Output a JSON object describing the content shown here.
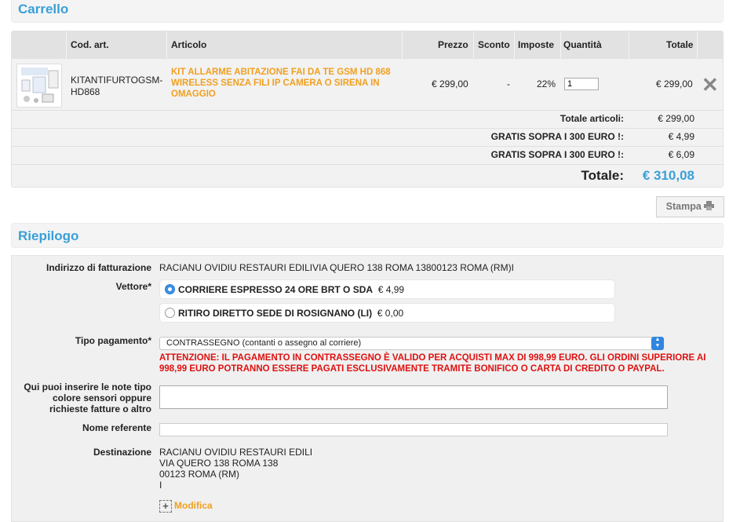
{
  "cart": {
    "title": "Carrello",
    "headers": [
      "Cod. art.",
      "Articolo",
      "Prezzo",
      "Sconto",
      "Imposte",
      "Quantità",
      "Totale"
    ],
    "item": {
      "code": "KITANTIFURTOGSM-HD868",
      "name": "KIT ALLARME ABITAZIONE FAI DA TE GSM HD 868 WIRELESS SENZA FILI IP CAMERA O SIRENA IN OMAGGIO",
      "price": "€ 299,00",
      "discount": "-",
      "tax": "22%",
      "quantity": "1",
      "total": "€ 299,00"
    },
    "summary": [
      {
        "label": "Totale articoli:",
        "value": "€ 299,00"
      },
      {
        "label": "GRATIS SOPRA I 300 EURO !:",
        "value": "€ 4,99"
      },
      {
        "label": "GRATIS SOPRA I 300 EURO !:",
        "value": "€ 6,09"
      }
    ],
    "grand_total_label": "Totale:",
    "grand_total_value": "€ 310,08",
    "print_label": "Stampa"
  },
  "summary": {
    "title": "Riepilogo",
    "billing_label": "Indirizzo di fatturazione",
    "billing_value": "RACIANU OVIDIU RESTAURI EDILIVIA QUERO 138 ROMA 13800123 ROMA (RM)I",
    "carrier_label": "Vettore*",
    "carriers": [
      {
        "name": "CORRIERE ESPRESSO 24 ORE BRT O SDA",
        "price": "€ 4,99",
        "selected": true
      },
      {
        "name": "RITIRO DIRETTO SEDE DI ROSIGNANO (LI)",
        "price": "€ 0,00",
        "selected": false
      }
    ],
    "payment_label": "Tipo pagamento*",
    "payment_value": "CONTRASSEGNO (contanti o assegno al corriere)",
    "warning": "ATTENZIONE: IL PAGAMENTO IN CONTRASSEGNO È VALIDO PER ACQUISTI MAX DI 998,99 EURO. GLI ORDINI SUPERIORE AI 998,99 EURO POTRANNO ESSERE PAGATI ESCLUSIVAMENTE TRAMITE BONIFICO O CARTA DI CREDITO O PAYPAL.",
    "notes_label": "Qui puoi inserire le note tipo colore sensori oppure richieste fatture o altro",
    "referent_label": "Nome referente",
    "destination_label": "Destinazione",
    "destination_lines": [
      "RACIANU OVIDIU RESTAURI EDILI",
      "VIA QUERO 138 ROMA 138",
      "00123 ROMA (RM)",
      "I"
    ],
    "edit_label": "Modifica"
  },
  "colors": {
    "accent_blue": "#3a9fd8",
    "orange": "#f0a020",
    "warning_red": "#e01010"
  },
  "icons": {
    "remove": "close-icon",
    "print": "printer-icon",
    "select": "chevron-updown-icon",
    "edit": "plus-icon"
  }
}
